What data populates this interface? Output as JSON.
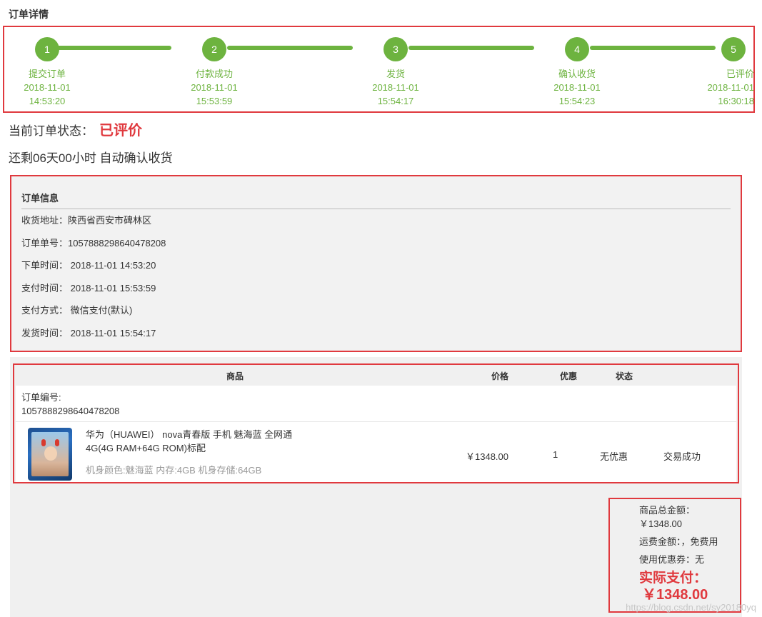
{
  "page_title": "订单详情",
  "steps": [
    {
      "num": "1",
      "label": "提交订单",
      "date": "2018-11-01",
      "time": "14:53:20"
    },
    {
      "num": "2",
      "label": "付款成功",
      "date": "2018-11-01",
      "time": "15:53:59"
    },
    {
      "num": "3",
      "label": "发货",
      "date": "2018-11-01",
      "time": "15:54:17"
    },
    {
      "num": "4",
      "label": "确认收货",
      "date": "2018-11-01",
      "time": "15:54:23"
    },
    {
      "num": "5",
      "label": "已评价",
      "date": "2018-11-01",
      "time": "16:30:18"
    }
  ],
  "status": {
    "label": "当前订单状态：",
    "value": "已评价"
  },
  "remaining": "还剩06天00小时 自动确认收货",
  "order_info": {
    "title": "订单信息",
    "rows": [
      "收货地址：陕西省西安市碑林区",
      "订单单号：1057888298640478208",
      "下单时间： 2018-11-01 14:53:20",
      "支付时间： 2018-11-01 15:53:59",
      "支付方式： 微信支付(默认)",
      "发货时间： 2018-11-01 15:54:17"
    ]
  },
  "table": {
    "headers": {
      "product": "商品",
      "price": "价格",
      "discount": "优惠",
      "status": "状态"
    },
    "order_no_label": "订单编号:",
    "order_no": "1057888298640478208",
    "item": {
      "name": "华为（HUAWEI） nova青春版 手机 魅海蓝 全网通4G(4G RAM+64G ROM)标配",
      "spec": "机身颜色:魅海蓝 内存:4GB 机身存储:64GB",
      "price": "￥1348.00",
      "quantity": "1",
      "discount": "无优惠",
      "status": "交易成功"
    }
  },
  "summary": {
    "total_label": "商品总金额：",
    "total_value": "￥1348.00",
    "shipping": "运费金额：，免费用",
    "coupon": "使用优惠券：无",
    "paid_label": "实际支付：",
    "paid_value": "￥1348.00"
  },
  "watermark": "https://blog.csdn.net/sy20180yq",
  "colors": {
    "accent_green": "#6db33f",
    "highlight_red": "#e0393e"
  }
}
